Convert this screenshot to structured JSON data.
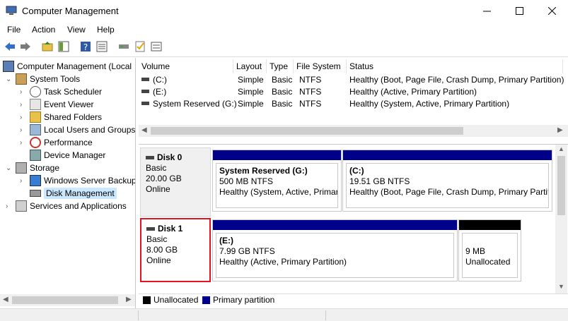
{
  "window": {
    "title": "Computer Management"
  },
  "menu": {
    "file": "File",
    "action": "Action",
    "view": "View",
    "help": "Help"
  },
  "tree": {
    "root": "Computer Management (Local",
    "system_tools": "System Tools",
    "task_scheduler": "Task Scheduler",
    "event_viewer": "Event Viewer",
    "shared_folders": "Shared Folders",
    "local_users": "Local Users and Groups",
    "performance": "Performance",
    "device_manager": "Device Manager",
    "storage": "Storage",
    "backup": "Windows Server Backup",
    "disk_mgmt": "Disk Management",
    "services": "Services and Applications"
  },
  "volumes": {
    "headers": [
      "Volume",
      "Layout",
      "Type",
      "File System",
      "Status"
    ],
    "rows": [
      {
        "volume": "(C:)",
        "layout": "Simple",
        "type": "Basic",
        "fs": "NTFS",
        "status": "Healthy (Boot, Page File, Crash Dump, Primary Partition)"
      },
      {
        "volume": "(E:)",
        "layout": "Simple",
        "type": "Basic",
        "fs": "NTFS",
        "status": "Healthy (Active, Primary Partition)"
      },
      {
        "volume": "System Reserved (G:)",
        "layout": "Simple",
        "type": "Basic",
        "fs": "NTFS",
        "status": "Healthy (System, Active, Primary Partition)"
      }
    ]
  },
  "disks": {
    "disk0": {
      "name": "Disk 0",
      "type": "Basic",
      "size": "20.00 GB",
      "state": "Online",
      "p1": {
        "title": "System Reserved  (G:)",
        "size": "500 MB NTFS",
        "status": "Healthy (System, Active, Primar"
      },
      "p2": {
        "title": "(C:)",
        "size": "19.51 GB NTFS",
        "status": "Healthy (Boot, Page File, Crash Dump, Primary Partiti"
      }
    },
    "disk1": {
      "name": "Disk 1",
      "type": "Basic",
      "size": "8.00 GB",
      "state": "Online",
      "p1": {
        "title": "(E:)",
        "size": "7.99 GB NTFS",
        "status": "Healthy (Active, Primary Partition)"
      },
      "p2": {
        "size": "9 MB",
        "status": "Unallocated"
      }
    }
  },
  "legend": {
    "unallocated": "Unallocated",
    "primary": "Primary partition"
  },
  "colors": {
    "primary": "#00008b",
    "unallocated": "#000000",
    "highlight": "#e81123"
  }
}
